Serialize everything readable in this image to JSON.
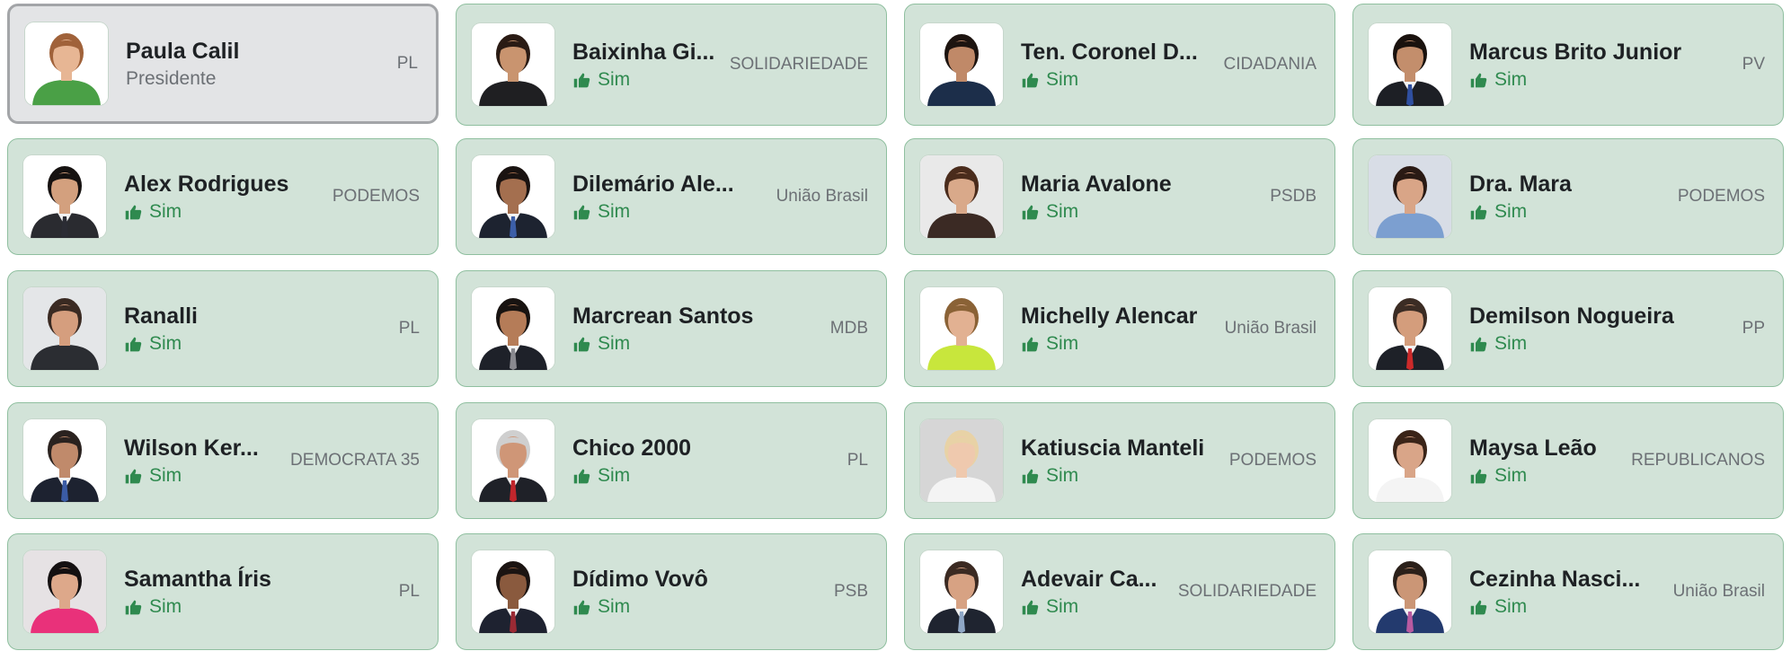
{
  "members": [
    {
      "name": "Paula Calil",
      "party": "PL",
      "status": "Presidente",
      "is_president": true,
      "photo": {
        "bg": "#ffffff",
        "skin": "#e7b694",
        "hair": "#a0623a",
        "suit": "#4aa046",
        "tie": null
      }
    },
    {
      "name": "Baixinha Gi...",
      "party": "SOLIDARIEDADE",
      "vote": "Sim",
      "photo": {
        "bg": "#ffffff",
        "skin": "#c9946f",
        "hair": "#2a1b14",
        "suit": "#1f1f22",
        "tie": null
      }
    },
    {
      "name": "Ten. Coronel D...",
      "party": "CIDADANIA",
      "vote": "Sim",
      "photo": {
        "bg": "#ffffff",
        "skin": "#c08968",
        "hair": "#1d1410",
        "suit": "#1c2e4a",
        "tie": null
      }
    },
    {
      "name": "Marcus Brito Junior",
      "party": "PV",
      "vote": "Sim",
      "photo": {
        "bg": "#ffffff",
        "skin": "#c38e6c",
        "hair": "#1a120e",
        "suit": "#1d1f25",
        "tie": "#2f4fa0"
      }
    },
    {
      "name": "Alex Rodrigues",
      "party": "PODEMOS",
      "vote": "Sim",
      "photo": {
        "bg": "#ffffff",
        "skin": "#d3a07e",
        "hair": "#161211",
        "suit": "#2a2b30",
        "tie": "#2b2c34"
      }
    },
    {
      "name": "Dilemário Ale...",
      "party": "União Brasil",
      "vote": "Sim",
      "photo": {
        "bg": "#ffffff",
        "skin": "#a46f4f",
        "hair": "#1a1311",
        "suit": "#1d2330",
        "tie": "#3c5fa8"
      }
    },
    {
      "name": "Maria Avalone",
      "party": "PSDB",
      "vote": "Sim",
      "photo": {
        "bg": "#e9e9e9",
        "skin": "#d9a98a",
        "hair": "#4a2c1c",
        "suit": "#3b2a24",
        "tie": null
      }
    },
    {
      "name": "Dra. Mara",
      "party": "PODEMOS",
      "vote": "Sim",
      "photo": {
        "bg": "#d8dde6",
        "skin": "#d9a587",
        "hair": "#2a1a14",
        "suit": "#7c9fd0",
        "tie": null
      }
    },
    {
      "name": "Ranalli",
      "party": "PL",
      "vote": "Sim",
      "photo": {
        "bg": "#e4e6e8",
        "skin": "#d59e7e",
        "hair": "#3a2a22",
        "suit": "#2b2d32",
        "tie": null
      }
    },
    {
      "name": "Marcrean Santos",
      "party": "MDB",
      "vote": "Sim",
      "photo": {
        "bg": "#ffffff",
        "skin": "#b57c58",
        "hair": "#181311",
        "suit": "#1e2129",
        "tie": "#8a8a90"
      }
    },
    {
      "name": "Michelly Alencar",
      "party": "União Brasil",
      "vote": "Sim",
      "photo": {
        "bg": "#ffffff",
        "skin": "#e2b192",
        "hair": "#8a6236",
        "suit": "#c8e63c",
        "tie": null
      }
    },
    {
      "name": "Demilson Nogueira",
      "party": "PP",
      "vote": "Sim",
      "photo": {
        "bg": "#ffffff",
        "skin": "#d49d7c",
        "hair": "#3b2c24",
        "suit": "#1e2128",
        "tie": "#cc2a2a"
      }
    },
    {
      "name": "Wilson Ker...",
      "party": "DEMOCRATA 35",
      "vote": "Sim",
      "photo": {
        "bg": "#ffffff",
        "skin": "#c08a6b",
        "hair": "#2a221f",
        "suit": "#1d2230",
        "tie": "#3b5ca6"
      }
    },
    {
      "name": "Chico 2000",
      "party": "PL",
      "vote": "Sim",
      "photo": {
        "bg": "#ffffff",
        "skin": "#cf9677",
        "hair": "#cfcfcf",
        "suit": "#1f2128",
        "tie": "#c2262c"
      }
    },
    {
      "name": "Katiuscia Manteli",
      "party": "PODEMOS",
      "vote": "Sim",
      "photo": {
        "bg": "#d6d6d6",
        "skin": "#efc9ae",
        "hair": "#e8d2a6",
        "suit": "#f4f4f4",
        "tie": null
      }
    },
    {
      "name": "Maysa Leão",
      "party": "REPUBLICANOS",
      "vote": "Sim",
      "photo": {
        "bg": "#ffffff",
        "skin": "#d9a588",
        "hair": "#3a2418",
        "suit": "#f4f4f4",
        "tie": null
      }
    },
    {
      "name": "Samantha Íris",
      "party": "PL",
      "vote": "Sim",
      "photo": {
        "bg": "#e6e2e4",
        "skin": "#dda88a",
        "hair": "#141011",
        "suit": "#e9317a",
        "tie": null
      }
    },
    {
      "name": "Dídimo Vovô",
      "party": "PSB",
      "vote": "Sim",
      "photo": {
        "bg": "#ffffff",
        "skin": "#8a5a3e",
        "hair": "#1b1412",
        "suit": "#1e2230",
        "tie": "#9b2a34"
      }
    },
    {
      "name": "Adevair Ca...",
      "party": "SOLIDARIEDADE",
      "vote": "Sim",
      "photo": {
        "bg": "#ffffff",
        "skin": "#d7a283",
        "hair": "#3b2a22",
        "suit": "#1f2430",
        "tie": "#8fa7c6"
      }
    },
    {
      "name": "Cezinha Nasci...",
      "party": "União Brasil",
      "vote": "Sim",
      "photo": {
        "bg": "#ffffff",
        "skin": "#cb9676",
        "hair": "#2b201a",
        "suit": "#233a6e",
        "tie": "#b85aa0"
      }
    }
  ],
  "colors": {
    "card_bg": "#d2e3d8",
    "card_border": "#8fbf9f",
    "president_bg": "#e3e4e6",
    "president_border": "#a3a5a8",
    "vote_green": "#2f8a4f",
    "party_gray": "#6c7075"
  },
  "icons": {
    "vote": "thumbs-up-icon"
  }
}
